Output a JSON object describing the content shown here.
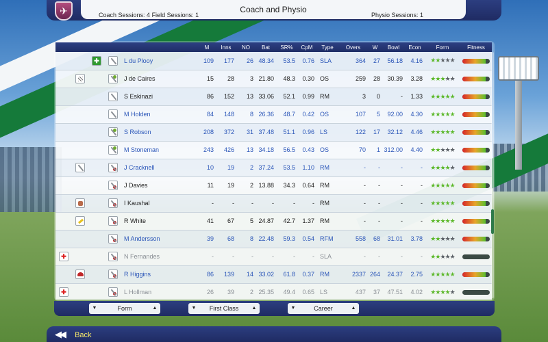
{
  "header": {
    "title": "Coach and Physio",
    "coach_sessions": "Coach Sessions: 4",
    "field_sessions": "Field Sessions: 1",
    "physio_sessions": "Physio Sessions: 1"
  },
  "columns": [
    "M",
    "Inns",
    "NO",
    "Bat",
    "SR%",
    "CpM",
    "Type",
    "Overs",
    "W",
    "Bowl",
    "Econ",
    "Form",
    "Fitness"
  ],
  "players": [
    {
      "name": "L du Plooy",
      "m": "109",
      "inns": "177",
      "no": "26",
      "bat": "48.34",
      "sr": "53.5",
      "cpm": "0.76",
      "type": "SLA",
      "overs": "364",
      "w": "27",
      "bowl": "56.18",
      "econ": "4.16",
      "form": 2,
      "fitness": 0.85,
      "color": "blue",
      "status": "plus-green",
      "status_icon": "plus-icon",
      "role": "bat"
    },
    {
      "name": "J de Caires",
      "m": "15",
      "inns": "28",
      "no": "3",
      "bat": "21.80",
      "sr": "48.3",
      "cpm": "0.30",
      "type": "OS",
      "overs": "259",
      "w": "28",
      "bowl": "30.39",
      "econ": "3.28",
      "form": 3,
      "fitness": 0.85,
      "color": "dark",
      "status": "pad",
      "status_icon": "pad-icon",
      "role": "keep"
    },
    {
      "name": "S Eskinazi",
      "m": "86",
      "inns": "152",
      "no": "13",
      "bat": "33.06",
      "sr": "52.1",
      "cpm": "0.99",
      "type": "RM",
      "overs": "3",
      "w": "0",
      "bowl": "-",
      "econ": "1.33",
      "form": 5,
      "fitness": 0.85,
      "color": "dark",
      "status": "",
      "status_icon": "",
      "role": "bat"
    },
    {
      "name": "M Holden",
      "m": "84",
      "inns": "148",
      "no": "8",
      "bat": "26.36",
      "sr": "48.7",
      "cpm": "0.42",
      "type": "OS",
      "overs": "107",
      "w": "5",
      "bowl": "92.00",
      "econ": "4.30",
      "form": 5,
      "fitness": 0.85,
      "color": "blue",
      "status": "",
      "status_icon": "",
      "role": "bat"
    },
    {
      "name": "S Robson",
      "m": "208",
      "inns": "372",
      "no": "31",
      "bat": "37.48",
      "sr": "51.1",
      "cpm": "0.96",
      "type": "LS",
      "overs": "122",
      "w": "17",
      "bowl": "32.12",
      "econ": "4.46",
      "form": 5,
      "fitness": 0.85,
      "color": "blue",
      "status": "",
      "status_icon": "",
      "role": "keep"
    },
    {
      "name": "M Stoneman",
      "m": "243",
      "inns": "426",
      "no": "13",
      "bat": "34.18",
      "sr": "56.5",
      "cpm": "0.43",
      "type": "OS",
      "overs": "70",
      "w": "1",
      "bowl": "312.00",
      "econ": "4.40",
      "form": 2,
      "fitness": 0.85,
      "color": "blue",
      "status": "",
      "status_icon": "",
      "role": "keep"
    },
    {
      "name": "J Cracknell",
      "m": "10",
      "inns": "19",
      "no": "2",
      "bat": "37.24",
      "sr": "53.5",
      "cpm": "1.10",
      "type": "RM",
      "overs": "-",
      "w": "-",
      "bowl": "-",
      "econ": "-",
      "form": 4,
      "fitness": 0.85,
      "color": "blue",
      "status": "role",
      "status_icon": "bat-icon",
      "role": "ball"
    },
    {
      "name": "J Davies",
      "m": "11",
      "inns": "19",
      "no": "2",
      "bat": "13.88",
      "sr": "34.3",
      "cpm": "0.64",
      "type": "RM",
      "overs": "-",
      "w": "-",
      "bowl": "-",
      "econ": "-",
      "form": 5,
      "fitness": 0.85,
      "color": "dark",
      "status": "",
      "status_icon": "",
      "role": "ball"
    },
    {
      "name": "I Kaushal",
      "m": "-",
      "inns": "-",
      "no": "-",
      "bat": "-",
      "sr": "-",
      "cpm": "-",
      "type": "RM",
      "overs": "-",
      "w": "-",
      "bowl": "-",
      "econ": "-",
      "form": 5,
      "fitness": 0.85,
      "color": "dark",
      "status": "glove",
      "status_icon": "glove-icon",
      "role": "ball"
    },
    {
      "name": "R White",
      "m": "41",
      "inns": "67",
      "no": "5",
      "bat": "24.87",
      "sr": "42.7",
      "cpm": "1.37",
      "type": "RM",
      "overs": "-",
      "w": "-",
      "bowl": "-",
      "econ": "-",
      "form": 5,
      "fitness": 0.85,
      "color": "dark",
      "status": "note",
      "status_icon": "note-icon",
      "role": "ball"
    },
    {
      "name": "M Andersson",
      "m": "39",
      "inns": "68",
      "no": "8",
      "bat": "22.48",
      "sr": "59.3",
      "cpm": "0.54",
      "type": "RFM",
      "overs": "558",
      "w": "68",
      "bowl": "31.01",
      "econ": "3.78",
      "form": 2,
      "fitness": 0.85,
      "color": "blue",
      "status": "",
      "status_icon": "",
      "role": "ball"
    },
    {
      "name": "N Fernandes",
      "m": "-",
      "inns": "-",
      "no": "-",
      "bat": "-",
      "sr": "-",
      "cpm": "-",
      "type": "SLA",
      "overs": "-",
      "w": "-",
      "bowl": "-",
      "econ": "-",
      "form": 2,
      "fitness": 0,
      "color": "grey",
      "status": "plus-red",
      "status_icon": "red-cross-icon",
      "role": "ball"
    },
    {
      "name": "R Higgins",
      "m": "86",
      "inns": "139",
      "no": "14",
      "bat": "33.02",
      "sr": "61.8",
      "cpm": "0.37",
      "type": "RM",
      "overs": "2337",
      "w": "264",
      "bowl": "24.37",
      "econ": "2.75",
      "form": 5,
      "fitness": 0.85,
      "color": "blue",
      "status": "helmet",
      "status_icon": "helmet-icon",
      "role": "ball"
    },
    {
      "name": "L Hollman",
      "m": "26",
      "inns": "39",
      "no": "2",
      "bat": "25.35",
      "sr": "49.4",
      "cpm": "0.65",
      "type": "LS",
      "overs": "437",
      "w": "37",
      "bowl": "47.51",
      "econ": "4.02",
      "form": 4,
      "fitness": 0,
      "color": "grey",
      "status": "plus-red",
      "status_icon": "red-cross-icon",
      "role": "ball"
    }
  ],
  "filters": {
    "form": "Form",
    "competition": "First Class",
    "period": "Career"
  },
  "back_label": "Back",
  "icons": {
    "plus": "✚",
    "down": "▼",
    "up": "▲",
    "back": "◀◀",
    "star": "★",
    "logo": "✈"
  }
}
